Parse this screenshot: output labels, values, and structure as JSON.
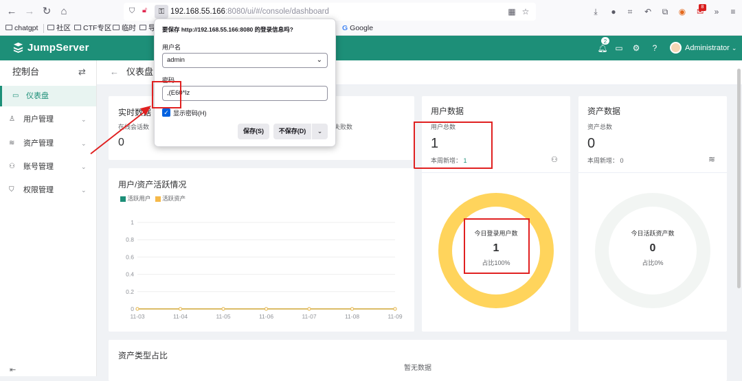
{
  "browser": {
    "url_host": "192.168.55.166",
    "url_rest": ":8080/ui/#/console/dashboard",
    "bookmarks": [
      "chatgpt",
      "社区",
      "CTF专区",
      "临时",
      "导",
      "Google"
    ],
    "extension_badge": "8"
  },
  "header": {
    "brand": "JumpServer",
    "notification_count": "2",
    "user": "Administrator"
  },
  "sidebar": {
    "title": "控制台",
    "items": [
      {
        "label": "仪表盘",
        "icon": "dashboard-icon"
      },
      {
        "label": "用户管理",
        "icon": "users-icon"
      },
      {
        "label": "资产管理",
        "icon": "stack-icon"
      },
      {
        "label": "账号管理",
        "icon": "account-icon"
      },
      {
        "label": "权限管理",
        "icon": "shield-icon"
      }
    ]
  },
  "page": {
    "title": "仪表盘"
  },
  "realtime": {
    "title": "实时数据",
    "session_label": "在线会话数",
    "session_value": "0",
    "fail_label": "登录失败数"
  },
  "user_data": {
    "title": "用户数据",
    "total_label": "用户总数",
    "total_value": "1",
    "weekly_label": "本周新增：",
    "weekly_value": "1",
    "donut_label": "今日登录用户数",
    "donut_value": "1",
    "donut_ratio": "占比100%",
    "donut_fraction": 1.0,
    "donut_color": "#ffd45c"
  },
  "asset_data": {
    "title": "资产数据",
    "total_label": "资产总数",
    "total_value": "0",
    "weekly_label": "本周新增：",
    "weekly_value": "0",
    "donut_label": "今日活跃资产数",
    "donut_value": "0",
    "donut_ratio": "占比0%",
    "donut_fraction": 0.0,
    "donut_color": "#f2f5f3"
  },
  "activity_chart": {
    "title": "用户/资产活跃情况",
    "legend": [
      {
        "label": "活跃用户",
        "color": "#1d8f78"
      },
      {
        "label": "活跃资产",
        "color": "#f5b94a"
      }
    ]
  },
  "asset_types": {
    "title": "资产类型占比",
    "empty_text": "暂无数据"
  },
  "save_dialog": {
    "title": "要保存 http://192.168.55.166:8080 的登录信息吗?",
    "username_label": "用户名",
    "username_value": "admin",
    "password_label": "密码",
    "password_value": ",(E60*lz",
    "show_password_label": "显示密码(H)",
    "save_button": "保存(S)",
    "dont_save_button": "不保存(D)"
  },
  "chart_data": {
    "type": "line",
    "categories": [
      "11-03",
      "11-04",
      "11-05",
      "11-06",
      "11-07",
      "11-08",
      "11-09"
    ],
    "y_tick_labels": [
      "0",
      "0.2",
      "0.4",
      "0.6",
      "0.8",
      "1"
    ],
    "ylim": [
      0,
      1
    ],
    "grid": true,
    "legend_position": "top-left",
    "series": [
      {
        "name": "活跃用户",
        "values": [
          0,
          0,
          0,
          0,
          0,
          0,
          0
        ],
        "color": "#1d8f78"
      },
      {
        "name": "活跃资产",
        "values": [
          0,
          0,
          0,
          0,
          0,
          0,
          0
        ],
        "color": "#f5b94a"
      }
    ]
  }
}
